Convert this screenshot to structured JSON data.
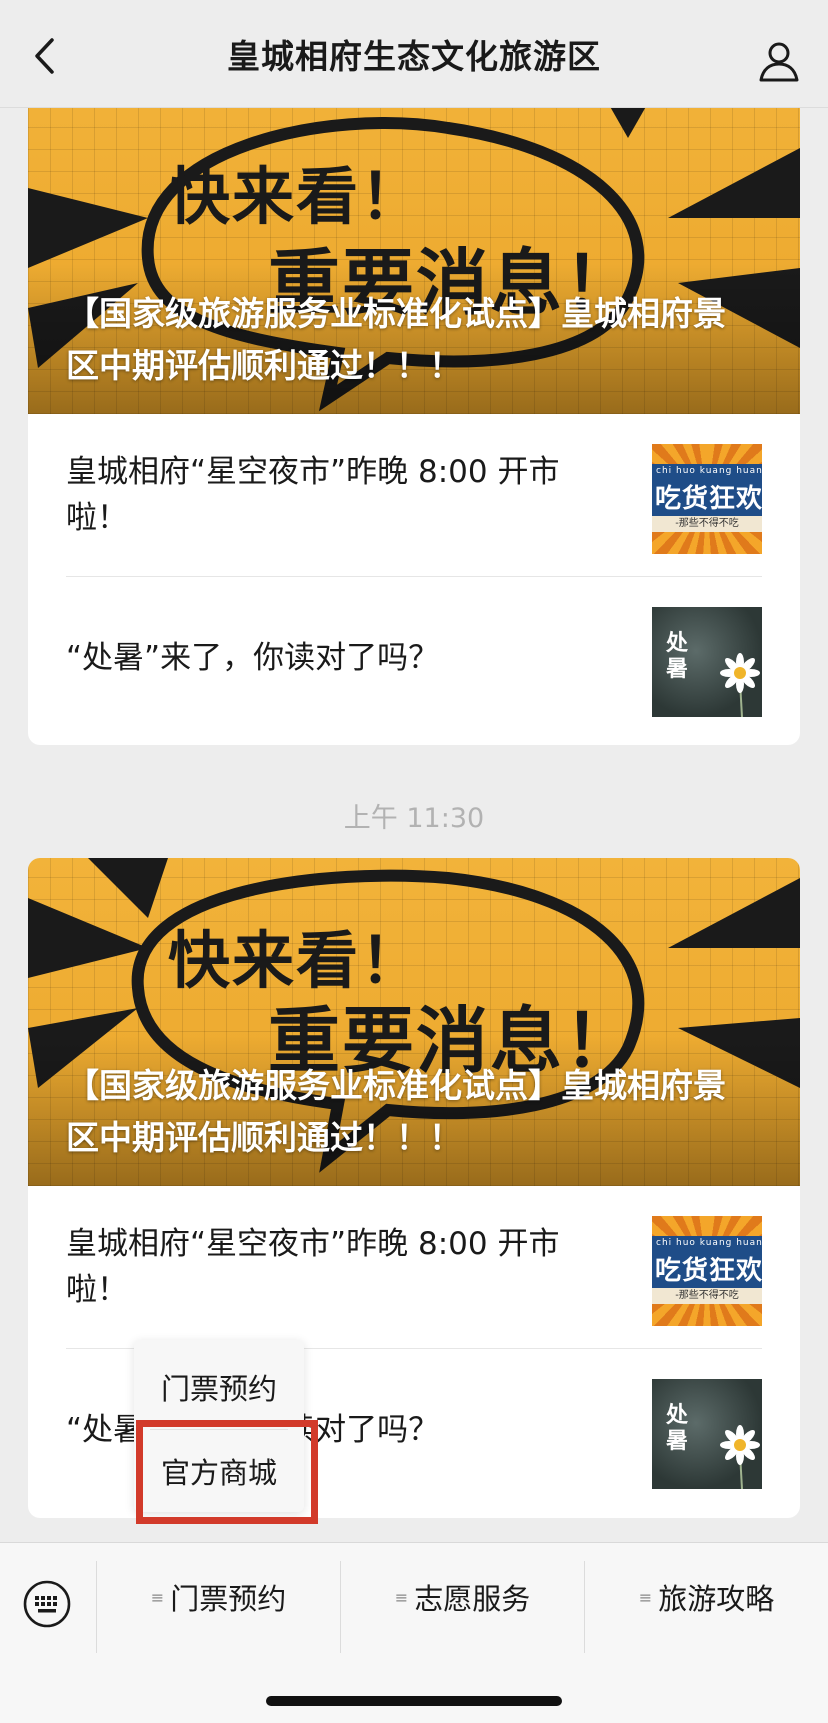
{
  "header": {
    "title": "皇城相府生态文化旅游区",
    "back_icon": "chevron-left-icon",
    "profile_icon": "person-icon"
  },
  "messages": [
    {
      "banner": {
        "art_line1": "快来看！",
        "art_line2": "重要消息！",
        "headline": "【国家级旅游服务业标准化试点】皇城相府景区中期评估顺利通过！！！"
      },
      "items": [
        {
          "title": "皇城相府“星空夜市”昨晚 8:00 开市啦！",
          "thumb": {
            "pinyin": "chi  huo  kuang  huan",
            "big": "吃货狂欢",
            "strip": "-那些不得不吃"
          }
        },
        {
          "title": "“处暑”来了，你读对了吗？",
          "thumb": {
            "chars": "处暑"
          }
        }
      ]
    },
    {
      "timestamp": "上午 11:30",
      "banner": {
        "art_line1": "快来看！",
        "art_line2": "重要消息！",
        "headline": "【国家级旅游服务业标准化试点】皇城相府景区中期评估顺利通过！！！"
      },
      "items": [
        {
          "title": "皇城相府“星空夜市”昨晚 8:00 开市啦！",
          "thumb": {
            "pinyin": "chi  huo  kuang  huan",
            "big": "吃货狂欢",
            "strip": "-那些不得不吃"
          }
        },
        {
          "title": "“处暑”来了，你读对了吗？",
          "thumb": {
            "chars": "处暑"
          }
        }
      ]
    }
  ],
  "popup_menu": {
    "options": [
      "门票预约",
      "官方商城"
    ],
    "highlighted": "官方商城",
    "highlight_color": "#d23a2a"
  },
  "bottom_menu": {
    "keyboard_icon": "keyboard-icon",
    "items": [
      "门票预约",
      "志愿服务",
      "旅游攻略"
    ],
    "menu_marker": "≡"
  }
}
